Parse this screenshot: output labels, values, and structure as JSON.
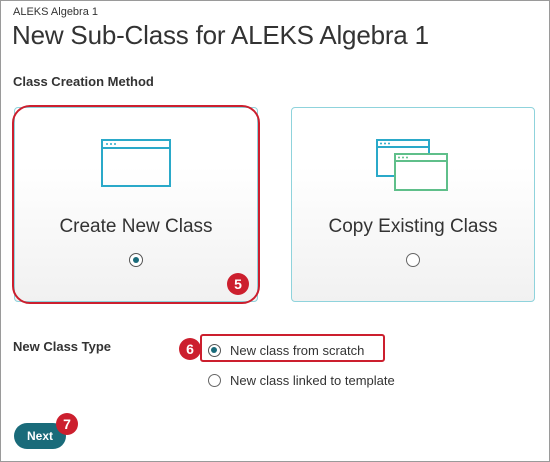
{
  "header": {
    "breadcrumb": "ALEKS Algebra 1",
    "title": "New Sub-Class for ALEKS Algebra 1"
  },
  "creation_method": {
    "label": "Class Creation Method",
    "options": [
      {
        "label": "Create New Class",
        "icon": "browser-window-icon",
        "selected": true
      },
      {
        "label": "Copy Existing Class",
        "icon": "copy-windows-icon",
        "selected": false
      }
    ]
  },
  "class_type": {
    "label": "New Class Type",
    "options": [
      {
        "label": "New class from scratch",
        "selected": true
      },
      {
        "label": "New class linked to template",
        "selected": false
      }
    ]
  },
  "actions": {
    "next_label": "Next"
  },
  "callouts": {
    "step5": "5",
    "step6": "6",
    "step7": "7"
  },
  "colors": {
    "accent": "#1a6b7a",
    "icon_teal": "#2aa9c9",
    "icon_green": "#5fbf8a",
    "callout_red": "#cc1f2e",
    "card_border": "#8fd3dc"
  }
}
